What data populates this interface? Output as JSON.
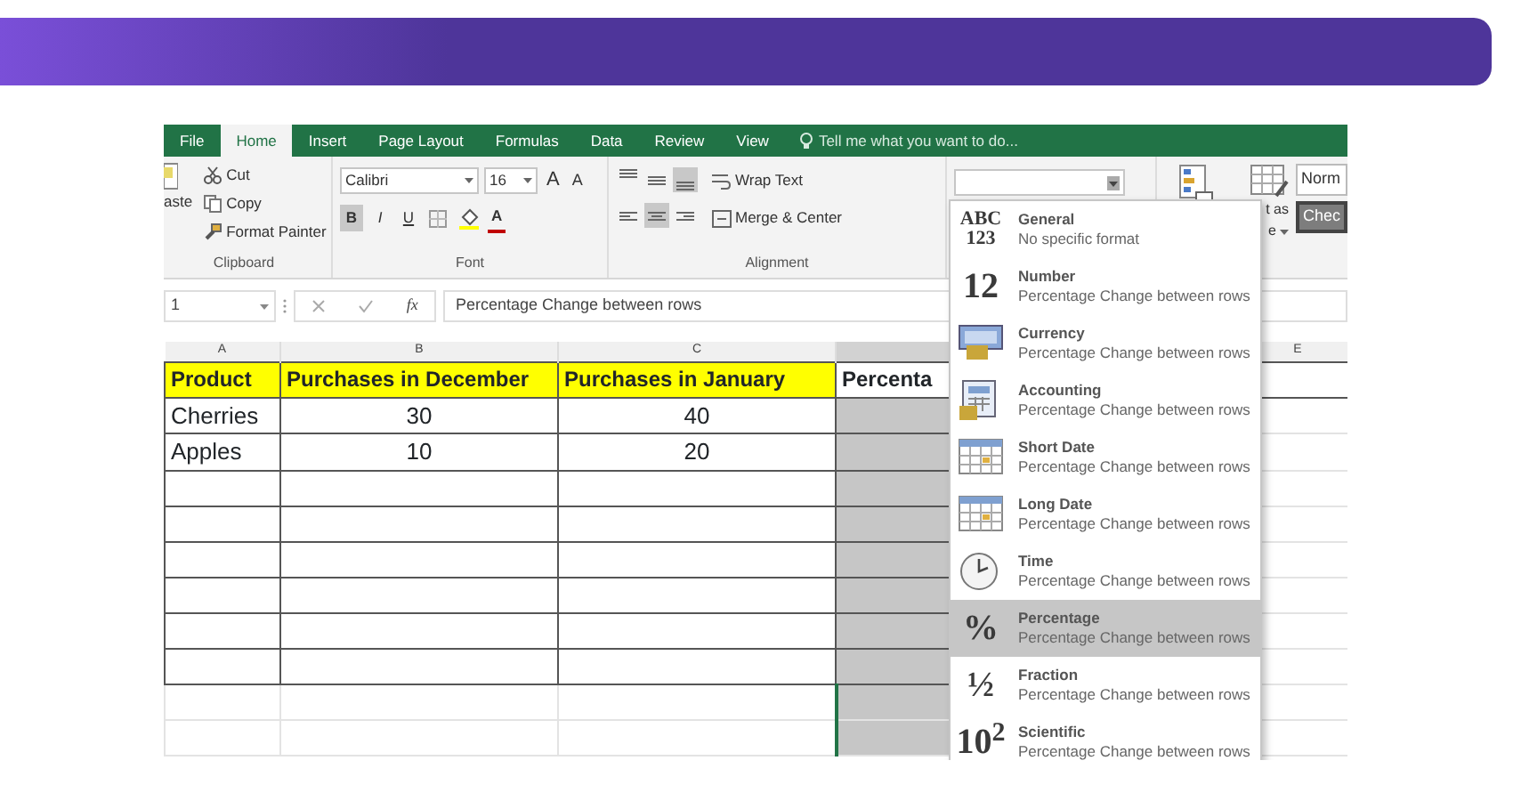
{
  "ribbon_tabs": [
    {
      "label": "File",
      "selected": false
    },
    {
      "label": "Home",
      "selected": true
    },
    {
      "label": "Insert",
      "selected": false
    },
    {
      "label": "Page Layout",
      "selected": false
    },
    {
      "label": "Formulas",
      "selected": false
    },
    {
      "label": "Data",
      "selected": false
    },
    {
      "label": "Review",
      "selected": false
    },
    {
      "label": "View",
      "selected": false
    }
  ],
  "tell_me": "Tell me what you want to do...",
  "clipboard": {
    "paste": "aste",
    "title": "Clipboard",
    "items": [
      {
        "kind": "cut",
        "label": "Cut"
      },
      {
        "kind": "copy",
        "label": "Copy"
      },
      {
        "kind": "painter",
        "label": "Format Painter"
      }
    ]
  },
  "font": {
    "title": "Font",
    "name": "Calibri",
    "size": "16",
    "grow": "A",
    "shrink": "A",
    "color_letter": "A",
    "styles": [
      {
        "label": "B",
        "on": true
      },
      {
        "label": "I",
        "on": false
      },
      {
        "label": "U",
        "on": false
      }
    ]
  },
  "alignment": {
    "title": "Alignment",
    "wrap": "Wrap Text",
    "merge": "Merge & Center",
    "buttons": [
      {
        "kind": "top",
        "on": false
      },
      {
        "kind": "middle",
        "on": false
      },
      {
        "kind": "bottom",
        "on": true
      },
      {
        "kind": "left",
        "on": false
      },
      {
        "kind": "center",
        "on": true
      },
      {
        "kind": "right",
        "on": false
      }
    ]
  },
  "styles": {
    "format_table": [
      "t as",
      "e"
    ],
    "cells": [
      {
        "label": "Norm",
        "selected": false
      },
      {
        "label": "Chec",
        "selected": true
      }
    ]
  },
  "formula_bar": {
    "name_box": "1",
    "function_label": "fx",
    "formula": "Percentage Change between rows"
  },
  "sheet": {
    "columns": [
      {
        "letter": "A",
        "selected": false
      },
      {
        "letter": "B",
        "selected": false
      },
      {
        "letter": "C",
        "selected": false
      },
      {
        "selected": true
      },
      {
        "letter": "E",
        "selected": false
      }
    ],
    "header": [
      "Product",
      "Purchases in December",
      "Purchases in January",
      "Percenta"
    ],
    "rows": [
      {
        "cells": [
          "Cherries",
          "30",
          "40"
        ]
      },
      {
        "cells": [
          "Apples",
          "10",
          "20"
        ]
      },
      {
        "bordered": true
      },
      {
        "bordered": true
      },
      {
        "bordered": true
      },
      {
        "bordered": true
      },
      {
        "bordered": true
      },
      {
        "bordered": true
      },
      {
        "bordered": false
      },
      {
        "bordered": false
      }
    ]
  },
  "number_format": {
    "items": [
      {
        "kind": "glyph",
        "glyph": "ABC",
        "glyph2": "123",
        "label": "General",
        "description": "No specific format",
        "selected": false
      },
      {
        "kind": "glyph",
        "glyph": "12",
        "label": "Number",
        "description": "Percentage Change between rows",
        "selected": false
      },
      {
        "kind": "currency",
        "label": "Currency",
        "description": "Percentage Change between rows",
        "selected": false
      },
      {
        "kind": "accounting",
        "label": "Accounting",
        "description": "Percentage Change between rows",
        "selected": false
      },
      {
        "kind": "calendar",
        "label": "Short Date",
        "description": "Percentage Change between rows",
        "selected": false
      },
      {
        "kind": "calendar",
        "label": "Long Date",
        "description": "Percentage Change between rows",
        "selected": false
      },
      {
        "kind": "clock",
        "label": "Time",
        "description": "Percentage Change between rows",
        "selected": false
      },
      {
        "kind": "glyph",
        "glyph": "%",
        "label": "Percentage",
        "description": "Percentage Change between rows",
        "selected": true
      },
      {
        "kind": "glyph",
        "glyph": "½",
        "label": "Fraction",
        "description": "Percentage Change between rows",
        "selected": false
      },
      {
        "kind": "glyph",
        "glyph": "10$^{2}$",
        "label": "Scientific",
        "description": "Percentage Change between rows",
        "selected": false
      }
    ]
  }
}
